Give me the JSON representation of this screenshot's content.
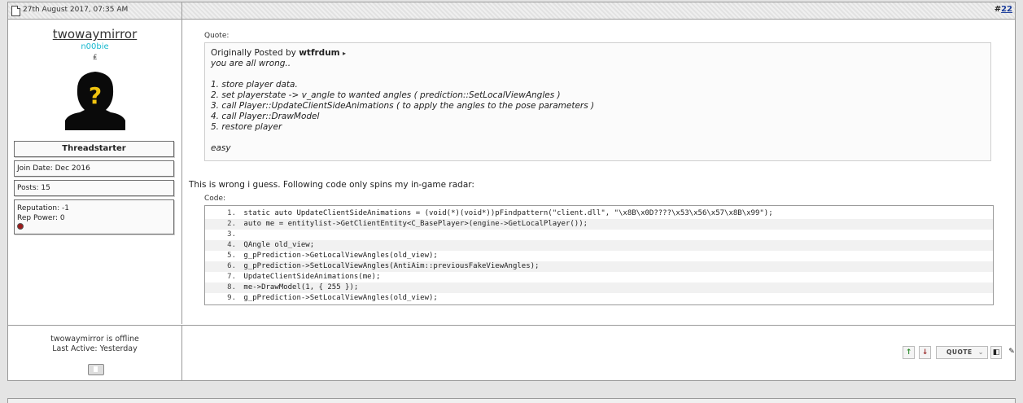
{
  "post": {
    "date": "27th August 2017, 07:35 AM",
    "number_prefix": "#",
    "number": "22"
  },
  "user": {
    "name": "twowaymirror",
    "title": "n00bie",
    "threadstarter": "Threadstarter",
    "join_date": "Join Date: Dec 2016",
    "posts": "Posts: 15",
    "reputation": "Reputation: -1",
    "rep_power": "Rep Power: 0",
    "status": "twowaymirror is offline",
    "last_active": "Last Active: Yesterday"
  },
  "quote": {
    "label": "Quote:",
    "originally_posted_by": "Originally Posted by",
    "author": "wtfrdum",
    "text": "you are all wrong..\n\n1. store player data.\n2. set playerstate -> v_angle to wanted angles ( prediction::SetLocalViewAngles )\n3. call Player::UpdateClientSideAnimations ( to apply the angles to the pose parameters )\n4. call Player::DrawModel\n5. restore player\n\neasy"
  },
  "body_text": "This is wrong i guess. Following code only spins my in-game radar:",
  "code": {
    "label": "Code:",
    "lines": [
      "static auto UpdateClientSideAnimations = (void(*)(void*))pFindpattern(\"client.dll\", \"\\x8B\\x0D????\\x53\\x56\\x57\\x8B\\x99\");",
      "auto me = entitylist->GetClientEntity<C_BasePlayer>(engine->GetLocalPlayer());",
      "",
      "QAngle old_view;",
      "g_pPrediction->GetLocalViewAngles(old_view);",
      "g_pPrediction->SetLocalViewAngles(AntiAim::previousFakeViewAngles);",
      "UpdateClientSideAnimations(me);",
      "me->DrawModel(1, { 255 });",
      "g_pPrediction->SetLocalViewAngles(old_view);"
    ],
    "line_numbers": [
      "1.",
      "2.",
      "3.",
      "4.",
      "5.",
      "6.",
      "7.",
      "8.",
      "9."
    ]
  },
  "buttons": {
    "quote": "QUOTE",
    "up": "↑",
    "down": "↓"
  },
  "colors": {
    "usertitle": "#19b9cf",
    "code_keyword": "#7a2a9a",
    "code_string": "#1a8a2a"
  }
}
